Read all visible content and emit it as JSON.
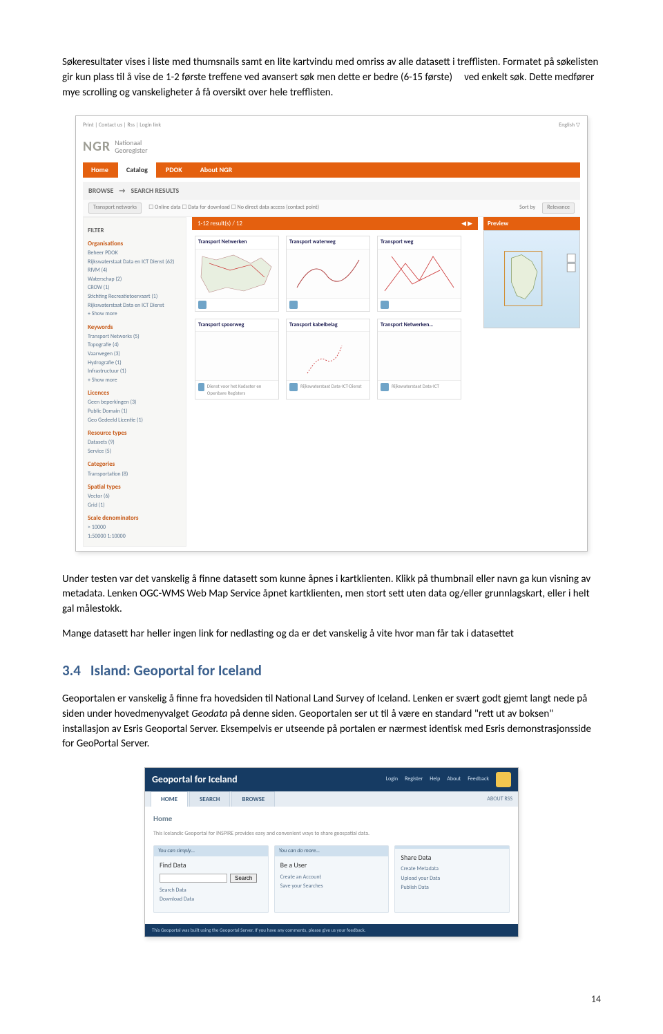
{
  "para1": "Søkeresultater vises i liste med thumsnails samt en lite kartvindu med omriss av alle datasett i trefflisten. Formatet på søkelisten gir kun plass til å vise de 1-2 første treffene ved avansert søk men dette er bedre (6-15 første)     ved enkelt søk. Dette medfører mye scrolling og vanskeligheter å få oversikt over hele trefflisten.",
  "ngr": {
    "topbar_left": "Print | Contact us | Rss | Login link",
    "topbar_right": "English ▽",
    "brand": "NGR",
    "brand_sub1": "Nationaal",
    "brand_sub2": "Georegister",
    "tabs": [
      "Home",
      "Catalog",
      "PDOK",
      "About NGR"
    ],
    "subhead_browse": "BROWSE",
    "subhead_arrow": "→",
    "subhead_results": "SEARCH RESULTS",
    "filter_term": "Transport networks",
    "filter_opts": "☐ Online data  ☐ Data for download  ☐ No direct data access (contact point)",
    "filter_sort_label": "Sort by",
    "filter_sort_value": "Relevance",
    "sidebar": {
      "filter_hd": "FILTER",
      "groups": [
        {
          "hd": "Organisations",
          "items": [
            "Beheer PDOK",
            "Rijkswaterstaat Data en ICT Dienst (62)",
            "RIVM (4)",
            "Waterschap (2)",
            "CROW (1)",
            "Stichting Recreatietoervaart (1)",
            "Rijkswaterstaat Data en ICT Dienst",
            "+ Show more"
          ]
        },
        {
          "hd": "Keywords",
          "items": [
            "Transport Networks (5)",
            "Topografie (4)",
            "Vaarwegen (3)",
            "Hydrografie (1)",
            "Infrastructuur (1)",
            "+ Show more"
          ]
        },
        {
          "hd": "Licences",
          "items": [
            "Geen beperkingen (3)",
            "Public Domain (1)",
            "Geo Gedeeld Licentie (1)"
          ]
        },
        {
          "hd": "Resource types",
          "items": [
            "Datasets (9)",
            "Service (5)"
          ]
        },
        {
          "hd": "Categories",
          "items": [
            "Transportation (8)"
          ]
        },
        {
          "hd": "Spatial types",
          "items": [
            "Vector (6)",
            "Grid (1)"
          ]
        },
        {
          "hd": "Scale denominators",
          "items": [
            "> 10000",
            "1:50000 1:10000"
          ]
        }
      ]
    },
    "resultbar_left": "1-12 result(s) / 12",
    "cards": [
      {
        "title": "Transport Netwerken"
      },
      {
        "title": "Transport waterweg"
      },
      {
        "title": "Transport weg"
      },
      {
        "title": "Transport spoorweg",
        "sub": "Dienst voor het Kadaster en Openbare Registers"
      },
      {
        "title": "Transport kabelbelag",
        "sub": "Rijkswaterstaat Data-ICT-Dienst"
      },
      {
        "title": "Transport Netwerken…",
        "sub": "Rijkswaterstaat Data-ICT"
      }
    ],
    "map_hd": "Preview"
  },
  "para2": "Under testen var det vanskelig å finne datasett som kunne åpnes i kartklienten. Klikk på thumbnail eller navn ga kun visning av metadata. Lenken OGC-WMS Web Map Service åpnet kartklienten, men stort sett uten data og/eller grunnlagskart, eller i helt gal målestokk.",
  "para3": "Mange datasett har heller ingen link for nedlasting og da er det vanskelig å vite hvor man får tak i datasettet",
  "heading": {
    "num": "3.4",
    "text": "Island: Geoportal for Iceland"
  },
  "para4a": "Geoportalen er vanskelig å finne fra hovedsiden til National Land Survey of Iceland. Lenken er svært godt gjemt langt nede på siden under hovedmenyvalget ",
  "para4link": "Geodata",
  "para4b": " på denne siden. Geoportalen ser ut til å være en standard \"rett ut av boksen\" installasjon av Esris Geoportal Server. Eksempelvis er utseende på portalen er nærmest identisk med Esris demonstrasjonsside for GeoPortal Server.",
  "gp": {
    "title": "Geoportal for Iceland",
    "toplinks": [
      "Login",
      "Register",
      "Help",
      "About",
      "Feedback"
    ],
    "tabs": [
      "HOME",
      "SEARCH",
      "BROWSE"
    ],
    "about": "ABOUT  RSS",
    "hd": "Home",
    "desc": "This Icelandic Geoportal for INSPIRE provides easy and convenient ways to share geospatial data.",
    "cols": [
      {
        "chd": "You can simply…",
        "big": "Find Data",
        "search_placeholder": "",
        "search_btn": "Search",
        "links": [
          "Search Data",
          "Download Data"
        ]
      },
      {
        "chd": "You can do more…",
        "big": "Be a User",
        "links": [
          "Create an Account",
          "Save your Searches"
        ]
      },
      {
        "chd": "",
        "big": "Share Data",
        "links": [
          "Create Metadata",
          "Upload your Data",
          "Publish Data"
        ]
      }
    ],
    "foot": "This Geoportal was built using the Geoportal Server. If you have any comments, please give us your feedback."
  },
  "page_num": "14"
}
